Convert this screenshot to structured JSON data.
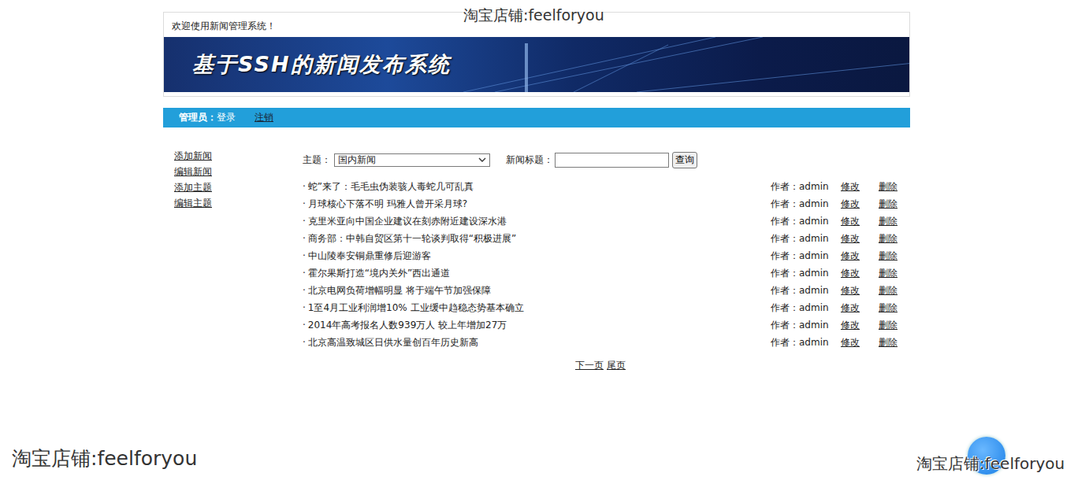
{
  "header": {
    "welcome": "欢迎使用新闻管理系统！",
    "banner_title": "基于SSH的新闻发布系统"
  },
  "nav": {
    "label": "管理员：",
    "login": "登录",
    "logout": "注销"
  },
  "sidebar": {
    "items": [
      "添加新闻",
      "编辑新闻",
      "添加主题",
      "编辑主题"
    ]
  },
  "filter": {
    "topic_label": "主题：",
    "topic_value": "国内新闻",
    "title_label": "新闻标题：",
    "title_value": "",
    "button": "查询"
  },
  "news": {
    "bullet": "·",
    "rows": [
      {
        "title": "蛇”来了：毛毛虫伪装骇人毒蛇几可乱真",
        "author": "作者：admin",
        "edit": "修改",
        "delete": "删除"
      },
      {
        "title": "月球核心下落不明 玛雅人曾开采月球?",
        "author": "作者：admin",
        "edit": "修改",
        "delete": "删除"
      },
      {
        "title": "克里米亚向中国企业建议在刻赤附近建设深水港",
        "author": "作者：admin",
        "edit": "修改",
        "delete": "删除"
      },
      {
        "title": "商务部：中韩自贸区第十一轮谈判取得“积极进展”",
        "author": "作者：admin",
        "edit": "修改",
        "delete": "删除"
      },
      {
        "title": "中山陵奉安铜鼎重修后迎游客",
        "author": "作者：admin",
        "edit": "修改",
        "delete": "删除"
      },
      {
        "title": "霍尔果斯打造“境内关外”西出通道",
        "author": "作者：admin",
        "edit": "修改",
        "delete": "删除"
      },
      {
        "title": "北京电网负荷增幅明显 将于端午节加强保障",
        "author": "作者：admin",
        "edit": "修改",
        "delete": "删除"
      },
      {
        "title": "1至4月工业利润增10% 工业缓中趋稳态势基本确立",
        "author": "作者：admin",
        "edit": "修改",
        "delete": "删除"
      },
      {
        "title": "2014年高考报名人数939万人 较上年增加27万",
        "author": "作者：admin",
        "edit": "修改",
        "delete": "删除"
      },
      {
        "title": "北京高温致城区日供水量创百年历史新高",
        "author": "作者：admin",
        "edit": "修改",
        "delete": "删除"
      }
    ]
  },
  "pagination": [
    "下一页",
    "尾页"
  ],
  "watermarks": [
    "淘宝店铺:feelforyou",
    "淘宝店铺:feelforyou",
    "淘宝店铺:feelforyou"
  ]
}
